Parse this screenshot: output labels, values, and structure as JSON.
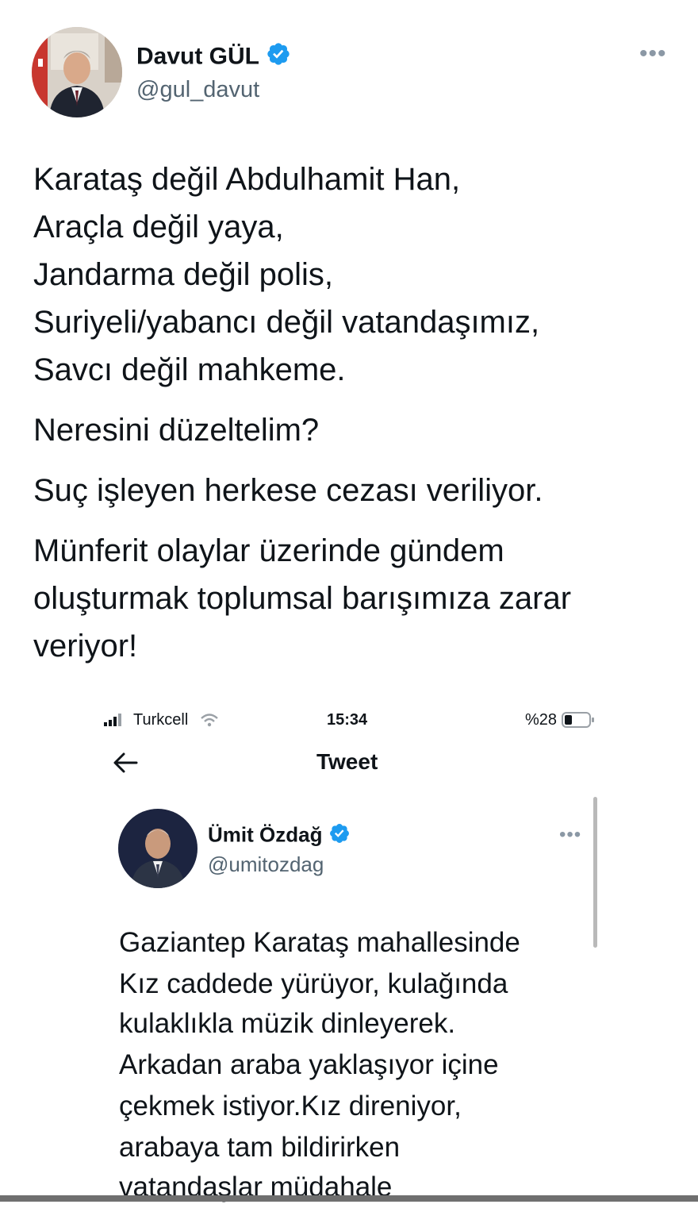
{
  "tweet": {
    "author": {
      "name": "Davut GÜL",
      "handle": "@gul_davut",
      "verified": true
    },
    "more_icon": "•••",
    "paragraphs": [
      [
        "Karataş değil Abdulhamit Han,",
        "Araçla değil yaya,",
        "Jandarma değil polis,",
        "Suriyeli/yabancı değil vatandaşımız,",
        "Savcı değil mahkeme."
      ],
      [
        "Neresini düzeltelim?"
      ],
      [
        "Suç işleyen herkese cezası veriliyor."
      ],
      [
        "Münferit olaylar üzerinde gündem",
        "oluşturmak toplumsal barışımıza zarar",
        "veriyor!"
      ]
    ]
  },
  "embedded_screenshot": {
    "status_bar": {
      "carrier": "Turkcell",
      "time": "15:34",
      "battery": "%28"
    },
    "nav": {
      "title": "Tweet",
      "back_icon": "arrow-left-icon"
    },
    "quoted_tweet": {
      "author": {
        "name": "Ümit Özdağ",
        "handle": "@umitozdag",
        "verified": true
      },
      "more_icon": "•••",
      "lines": [
        "Gaziantep Karataş mahallesinde",
        "Kız caddede yürüyor, kulağında",
        "kulaklıkla müzik dinleyerek.",
        "Arkadan araba yaklaşıyor içine",
        "çekmek istiyor.Kız direniyor,",
        "arabaya tam bildirirken",
        "vatandaşlar müdahale"
      ]
    }
  },
  "colors": {
    "text": "#0f1419",
    "secondary": "#536471",
    "verified_blue": "#1d9bf0"
  }
}
